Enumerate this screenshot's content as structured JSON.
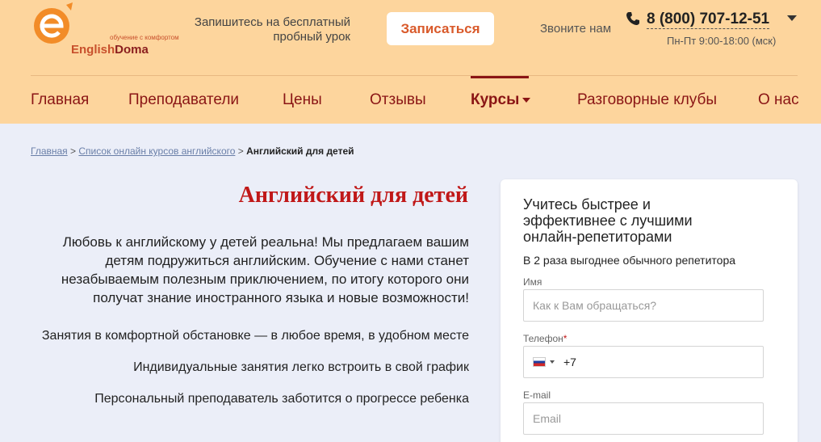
{
  "header": {
    "logo": {
      "name_part1": "English",
      "name_part2": "Doma",
      "tagline": "обучение с комфортом"
    },
    "promo_text": "Запишитесь на бесплатный пробный урок",
    "cta_label": "Записаться",
    "call_label": "Звоните нам",
    "phone": "8 (800) 707-12-51",
    "hours": "Пн-Пт 9:00-18:00 (мск)"
  },
  "nav": {
    "items": [
      {
        "label": "Главная"
      },
      {
        "label": "Преподаватели"
      },
      {
        "label": "Цены"
      },
      {
        "label": "Отзывы"
      },
      {
        "label": "Курсы"
      },
      {
        "label": "Разговорные клубы"
      },
      {
        "label": "О нас"
      }
    ],
    "active": "Курсы"
  },
  "breadcrumb": {
    "items": [
      "Главная",
      "Список онлайн курсов английского"
    ],
    "separator": ">",
    "current": "Английский для детей"
  },
  "main": {
    "title": "Английский для детей",
    "intro": "Любовь к английскому у детей реальна! Мы предлагаем вашим детям подружиться английским. Обучение с нами станет незабываемым полезным приключением, по итогу которого они получат знание иностранного языка и новые возможности!",
    "benefits": [
      "Занятия в комфортной обстановке — в любое время, в удобном месте",
      "Индивидуальные занятия легко встроить в свой график",
      "Персональный преподаватель заботится о прогрессе ребенка"
    ]
  },
  "form": {
    "title": "Учитесь быстрее и эффективнее с лучшими онлайн-репетиторами",
    "subtitle": "В 2 раза выгоднее обычного репетитора",
    "name_label": "Имя",
    "name_placeholder": "Как к Вам обращаться?",
    "phone_label": "Телефон",
    "phone_required_mark": "*",
    "phone_dial_code": "+7",
    "email_label": "E-mail",
    "email_placeholder": "Email"
  },
  "colors": {
    "header_bg": "#fdd59d",
    "brand_red": "#c01818",
    "nav_text": "#8a1515",
    "cta_text": "#d95a2b",
    "page_bg": "#ebeef8"
  },
  "icons": [
    "logo-e-icon",
    "phone-icon",
    "dropdown-caret-icon",
    "russia-flag-icon"
  ]
}
